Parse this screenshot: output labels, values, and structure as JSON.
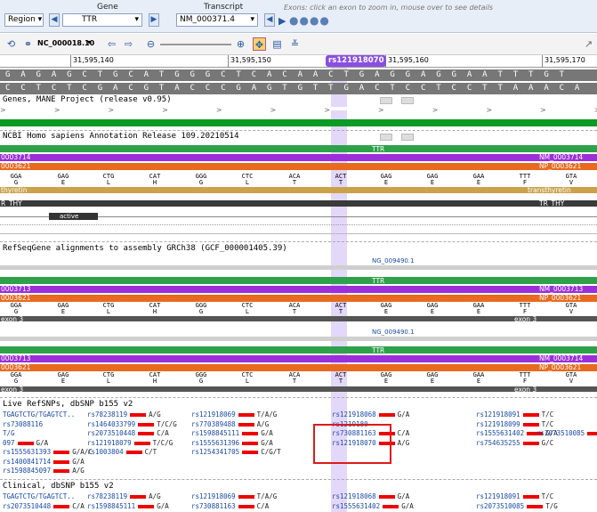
{
  "header": {
    "gene_label": "Gene",
    "transcript_label": "Transcript",
    "hint": "Exons: click an exon to zoom in, mouse over to see details",
    "region_label": "Region",
    "gene_value": "TTR",
    "transcript_value": "NM_000371.4"
  },
  "toolbar": {
    "accession": "NC_000018.10"
  },
  "ruler": {
    "marks": [
      "31,595,140",
      "31,595,150",
      "31,595,160",
      "31,595,170"
    ],
    "highlight": "rs121918070"
  },
  "sequence": {
    "forward": "GAGAGCTGCATGGGCTCACAACTGAGGAGGAATTTGT",
    "reverse": "CCTCTCGACGTACCCGAGTGTTGACTCCTCCTTAAACA"
  },
  "tracks": {
    "genes": "Genes, MANE Project (release v0.95)",
    "ncbi": "NCBI Homo sapiens Annotation Release 109.20210514",
    "refseqgene": "RefSeqGene alignments to assembly GRCh38 (GCF_000001405.39)",
    "live_snps": "Live RefSNPs, dbSNP b155 v2",
    "clinical": "Clinical, dbSNP b155 v2"
  },
  "features": {
    "ttr": "TTR",
    "nm_left": "0003714",
    "nm_right": "NM_0003714",
    "np_left": "0003621",
    "np_right": "NP_0003621",
    "thyretin_left": "thyretin",
    "thyretin_right": "transthyretin",
    "rthy_left": "R_THY",
    "rthy_right": "TR_THY",
    "active": "active",
    "ng1": "NG_009490.1",
    "nm2_left": "0003713",
    "nm2_right": "NM_0003713",
    "exon3": "exon 3"
  },
  "codons": [
    {
      "c": "GGA",
      "a": "G"
    },
    {
      "c": "GAG",
      "a": "E"
    },
    {
      "c": "CTG",
      "a": "L"
    },
    {
      "c": "CAT",
      "a": "H"
    },
    {
      "c": "GGG",
      "a": "G"
    },
    {
      "c": "CTC",
      "a": "L"
    },
    {
      "c": "ACA",
      "a": "T"
    },
    {
      "c": "ACT",
      "a": "T"
    },
    {
      "c": "GAG",
      "a": "E"
    },
    {
      "c": "GAG",
      "a": "E"
    },
    {
      "c": "GAA",
      "a": "E"
    },
    {
      "c": "TTT",
      "a": "F"
    },
    {
      "c": "GTA",
      "a": "V"
    }
  ],
  "snps_live": [
    [
      "TGAGTCTG/TGAGTCT..",
      "rs78238119 A/G",
      "rs121918069 T/A/G",
      "rs121918068 G/A",
      "rs121918091 T/C"
    ],
    [
      "rs73088116",
      "rs1464033799 T/C/G",
      "rs770389488 A/G",
      "rs1219180",
      "rs121918099 T/C"
    ],
    [
      "T/G",
      "rs2073510448 C/A",
      "rs1598845111 G/A",
      "rs730881163 C/A",
      "rs1555631402 G/A",
      "rs2073510085 T/G"
    ],
    [
      "097 G/A",
      "rs121918079 T/C/G",
      "rs1555631396 G/A",
      "rs121918070 A/G",
      "rs754635255 G/C"
    ],
    [
      "rs1555631393 G/A/C",
      "rs1003804 C/T",
      "rs1254341705 C/G/T"
    ],
    [
      "rs1400841714 G/A"
    ],
    [
      "rs1598845097 A/G"
    ]
  ],
  "snps_clinical": [
    [
      "TGAGTCTG/TGAGTCT..",
      "rs78238119 A/G",
      "rs121918069 T/A/G",
      "rs121918068 G/A",
      "rs121918091 T/C"
    ],
    [
      "rs2073510448 C/A",
      "rs1598845111 G/A",
      "rs730881163 C/A",
      "rs1555631402 G/A",
      "rs2073510085 T/G"
    ]
  ],
  "colors": {
    "green": "#2ea14a",
    "purple": "#9b2fd9",
    "orange": "#e86a1f",
    "tan": "#c9a24a",
    "dark": "#333333",
    "highlight": "#b48cf0"
  }
}
